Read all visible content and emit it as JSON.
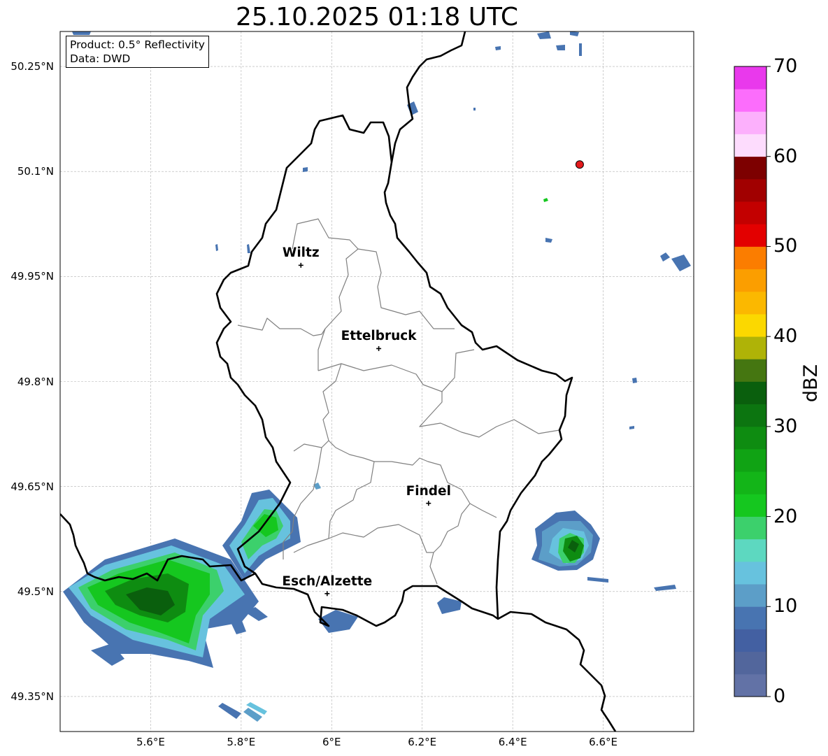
{
  "title": "25.10.2025 01:18 UTC",
  "info": {
    "product": "Product: 0.5° Reflectivity",
    "data_source": "Data: DWD"
  },
  "map": {
    "extent": {
      "lon": [
        5.4,
        6.8
      ],
      "lat": [
        49.3,
        50.3
      ]
    },
    "lat_ticks": [
      {
        "value": 50.25,
        "label": "50.25°N"
      },
      {
        "value": 50.1,
        "label": "50.1°N"
      },
      {
        "value": 49.95,
        "label": "49.95°N"
      },
      {
        "value": 49.8,
        "label": "49.8°N"
      },
      {
        "value": 49.65,
        "label": "49.65°N"
      },
      {
        "value": 49.5,
        "label": "49.5°N"
      },
      {
        "value": 49.35,
        "label": "49.35°N"
      }
    ],
    "lon_ticks": [
      {
        "value": 5.6,
        "label": "5.6°E"
      },
      {
        "value": 5.8,
        "label": "5.8°E"
      },
      {
        "value": 6.0,
        "label": "6°E"
      },
      {
        "value": 6.2,
        "label": "6.2°E"
      },
      {
        "value": 6.4,
        "label": "6.4°E"
      },
      {
        "value": 6.6,
        "label": "6.6°E"
      }
    ],
    "cities": [
      {
        "name": "Wiltz",
        "lon": 5.932,
        "lat": 49.966
      },
      {
        "name": "Ettelbruck",
        "lon": 6.104,
        "lat": 49.847
      },
      {
        "name": "Findel",
        "lon": 6.214,
        "lat": 49.626
      },
      {
        "name": "Esch/Alzette",
        "lon": 5.99,
        "lat": 49.497
      }
    ],
    "radar_site": {
      "lon": 6.548,
      "lat": 50.11,
      "color": "#e31a1c"
    },
    "echo_areas": [
      {
        "lon": 5.62,
        "lat": 49.52,
        "max_dbz": 27
      },
      {
        "lon": 5.86,
        "lat": 49.61,
        "max_dbz": 22
      },
      {
        "lon": 6.52,
        "lat": 49.57,
        "max_dbz": 32
      },
      {
        "lon": 6.0,
        "lat": 49.46,
        "max_dbz": 8
      },
      {
        "lon": 6.26,
        "lat": 49.48,
        "max_dbz": 8
      },
      {
        "lon": 5.8,
        "lat": 49.33,
        "max_dbz": 14
      }
    ]
  },
  "colorbar": {
    "label": "dBZ",
    "min": 0,
    "max": 70,
    "step": 2.5,
    "ticks": [
      0,
      10,
      20,
      30,
      40,
      50,
      60,
      70
    ],
    "colors": [
      "#6272a6",
      "#52669c",
      "#4360a2",
      "#4874b1",
      "#5c9ec8",
      "#67c2de",
      "#5dd8c0",
      "#3cd06c",
      "#15c71f",
      "#13b518",
      "#10a314",
      "#0e8c11",
      "#0c7510",
      "#0a5f0d",
      "#457611",
      "#afb307",
      "#fbd800",
      "#fbb800",
      "#fb9e00",
      "#fb7d00",
      "#e30000",
      "#c30000",
      "#a10000",
      "#7d0000",
      "#fddcfd",
      "#fcb0fc",
      "#fc6dfc",
      "#e939ec"
    ]
  }
}
